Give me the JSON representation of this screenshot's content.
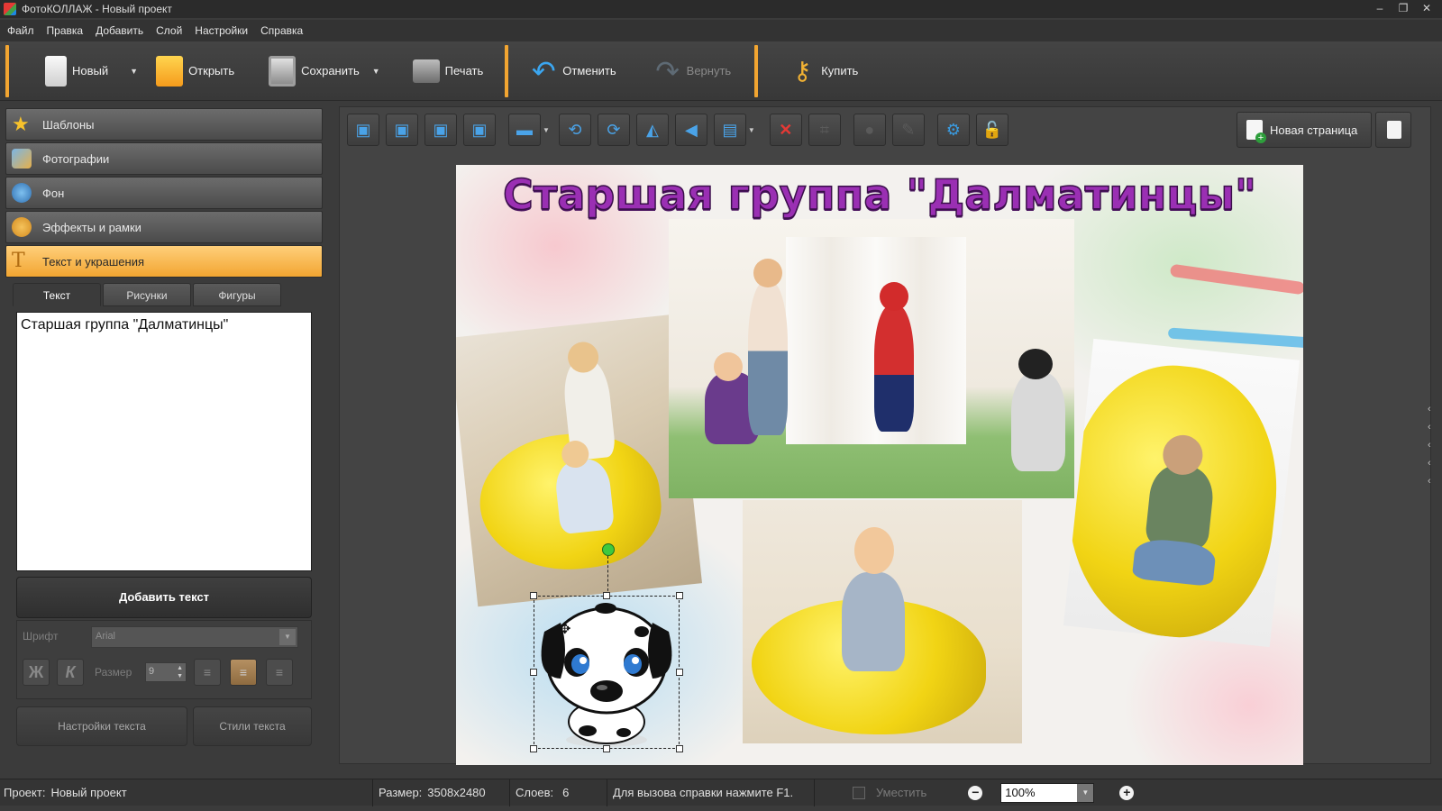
{
  "window": {
    "title": "ФотоКОЛЛАЖ - Новый проект",
    "controls": [
      "–",
      "❐",
      "✕"
    ]
  },
  "menu": [
    "Файл",
    "Правка",
    "Добавить",
    "Слой",
    "Настройки",
    "Справка"
  ],
  "toolbar": {
    "new": "Новый",
    "open": "Открыть",
    "save": "Сохранить",
    "print": "Печать",
    "undo": "Отменить",
    "redo": "Вернуть",
    "buy": "Купить"
  },
  "sidebar": {
    "items": [
      {
        "label": "Шаблоны",
        "icon": "star-icon",
        "active": false
      },
      {
        "label": "Фотографии",
        "icon": "photos-icon",
        "active": false
      },
      {
        "label": "Фон",
        "icon": "background-icon",
        "active": false
      },
      {
        "label": "Эффекты и рамки",
        "icon": "effects-icon",
        "active": false
      },
      {
        "label": "Текст и украшения",
        "icon": "text-icon",
        "active": true
      }
    ],
    "tabs": [
      {
        "label": "Текст",
        "active": true
      },
      {
        "label": "Рисунки",
        "active": false
      },
      {
        "label": "Фигуры",
        "active": false
      }
    ],
    "text_value": "Старшая группа \"Далматинцы\"",
    "add_text": "Добавить текст",
    "font_label": "Шрифт",
    "font_value": "Arial",
    "size_label": "Размер",
    "size_value": "9",
    "bold_glyph": "Ж",
    "italic_glyph": "К",
    "text_settings": "Настройки текста",
    "text_styles": "Стили текста"
  },
  "edit_toolbar": {
    "new_page": "Новая страница"
  },
  "canvas": {
    "title_text": "Старшая группа \"Далматинцы\""
  },
  "status": {
    "project_label": "Проект:",
    "project_value": "Новый проект",
    "size_label": "Размер:",
    "size_value": "3508x2480",
    "layers_label": "Слоев:",
    "layers_value": "6",
    "help": "Для вызова справки нажмите F1.",
    "fit": "Уместить",
    "zoom": "100%"
  },
  "colors": {
    "accent": "#f2a531",
    "title_purple": "#9a2fb3",
    "delete_red": "#e53935"
  }
}
